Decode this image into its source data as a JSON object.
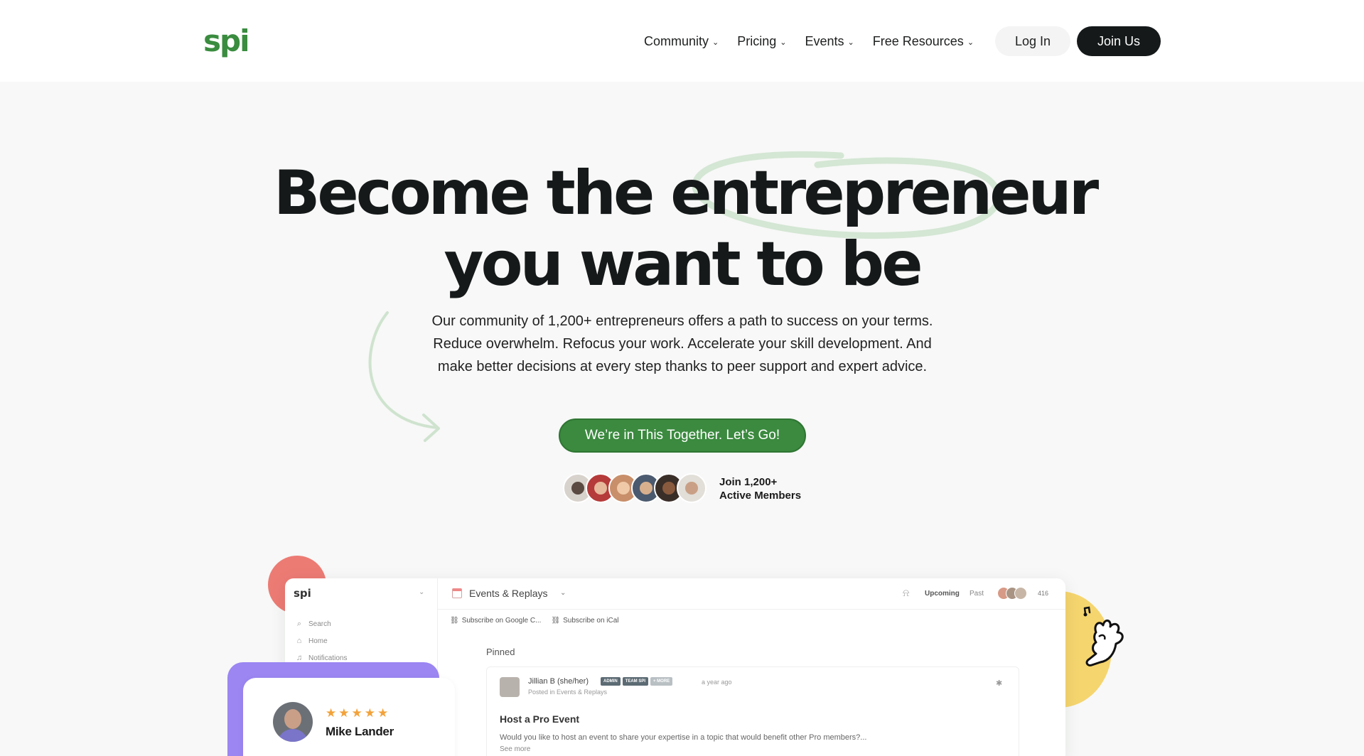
{
  "header": {
    "logo": "spi",
    "nav": [
      {
        "label": "Community"
      },
      {
        "label": "Pricing"
      },
      {
        "label": "Events"
      },
      {
        "label": "Free Resources"
      }
    ],
    "login_label": "Log In",
    "join_label": "Join Us"
  },
  "hero": {
    "title_line1": "Become the entrepreneur",
    "title_line2": "you want to be",
    "sub_line1": "Our community of 1,200+ entrepreneurs offers a path to success on your terms.",
    "sub_line2": "Reduce overwhelm. Refocus your work. Accelerate your skill development. And",
    "sub_line3": "make better decisions at every step thanks to peer support and expert advice.",
    "cta_label": "We’re in This Together. Let’s Go!",
    "members_line1": "Join 1,200+",
    "members_line2": "Active Members",
    "accent_color": "#3b8a3f"
  },
  "app_preview": {
    "logo": "spi",
    "sidebar": [
      {
        "label": "Search",
        "icon": "search-icon"
      },
      {
        "label": "Home",
        "icon": "home-icon"
      },
      {
        "label": "Notifications",
        "icon": "bell-icon"
      }
    ],
    "title": "Events & Replays",
    "tab_upcoming": "Upcoming",
    "tab_past": "Past",
    "member_count": "416",
    "subscribe_google": "Subscribe on Google C...",
    "subscribe_ical": "Subscribe on iCal",
    "pinned_label": "Pinned",
    "post": {
      "author": "Jillian B (she/her)",
      "tags": [
        "ADMIN",
        "TEAM SPI",
        "+ MORE"
      ],
      "time": "a year ago",
      "meta": "Posted in Events & Replays",
      "heading": "Host a Pro Event",
      "body": "Would you like to host an event to share your expertise in a topic that would benefit other Pro members?...",
      "see_more": "See more"
    }
  },
  "review": {
    "stars": "★★★★★",
    "name": "Mike Lander"
  }
}
